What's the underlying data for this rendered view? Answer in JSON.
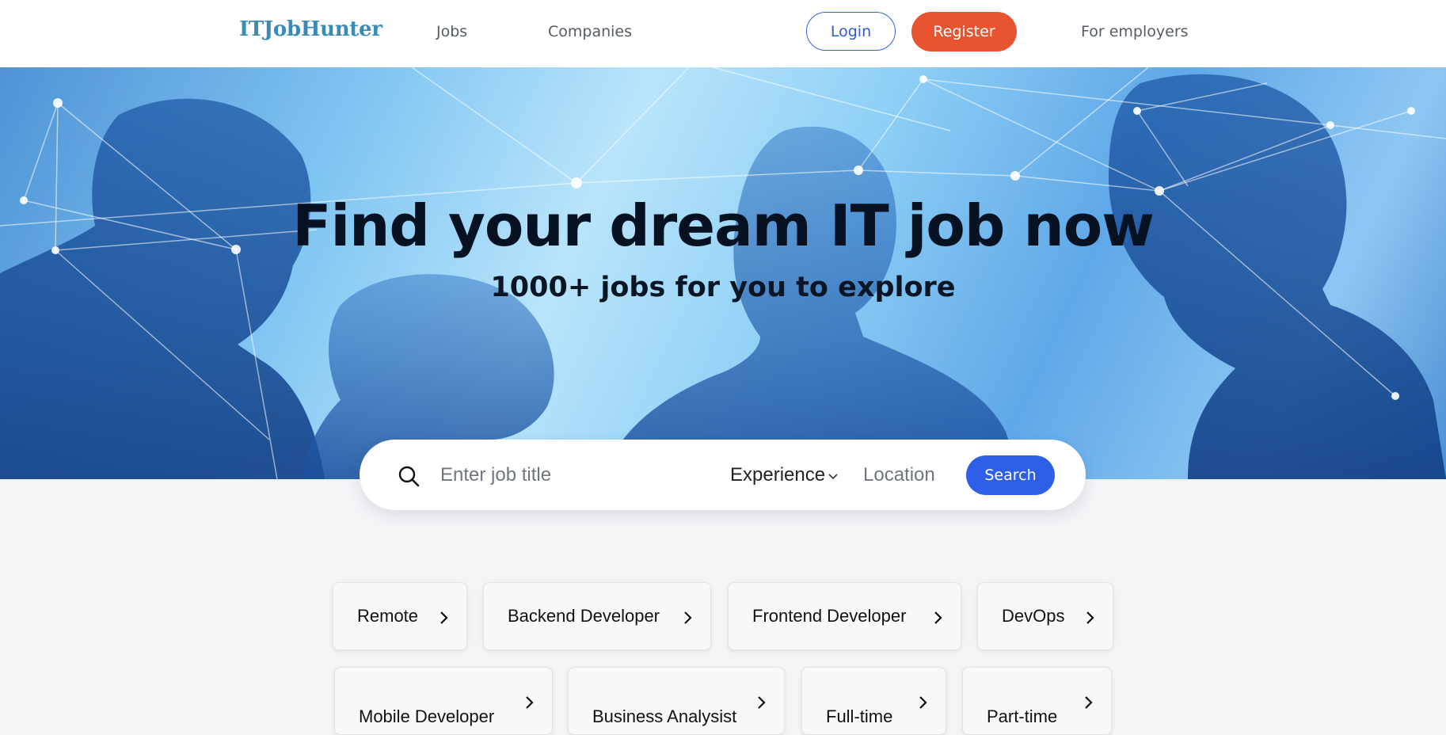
{
  "header": {
    "logo": "ITJobHunter",
    "nav": {
      "jobs": "Jobs",
      "companies": "Companies",
      "employers": "For employers"
    },
    "login_label": "Login",
    "register_label": "Register"
  },
  "hero": {
    "title": "Find your dream IT job now",
    "subtitle": "1000+ jobs for you to explore"
  },
  "search": {
    "job_placeholder": "Enter job title",
    "experience_label": "Experience",
    "location_placeholder": "Location",
    "button_label": "Search"
  },
  "categories": [
    {
      "label": "Remote"
    },
    {
      "label": "Backend Developer"
    },
    {
      "label": "Frontend Developer"
    },
    {
      "label": "DevOps"
    },
    {
      "label": "Mobile Developer"
    },
    {
      "label": "Business Analysist"
    },
    {
      "label": "Full-time"
    },
    {
      "label": "Part-time"
    }
  ],
  "colors": {
    "logo": "#3b8bb7",
    "register": "#e8542f",
    "login_border": "#3462d6",
    "search_button": "#2f5fe8",
    "page_background": "#f3f4f6"
  },
  "icons": {
    "search": "search-icon",
    "experience_dropdown": "chevron-down-icon",
    "category_arrow": "chevron-right-icon"
  }
}
